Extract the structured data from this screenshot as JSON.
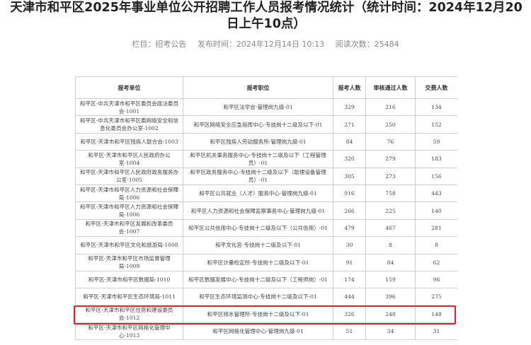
{
  "article": {
    "title": "天津市和平区2025年事业单位公开招聘工作人员报考情况统计（统计时间：2024年12月20日上午10点）",
    "column": "栏目：招考公告",
    "published": "发布时间：2024年12月14日 10:13",
    "views": "阅读次数：25484"
  },
  "table": {
    "headers": [
      "报考单位",
      "报考职位",
      "报考人数",
      "审核通过人数",
      "交费人数"
    ],
    "rows": [
      [
        "和平区-中共天津市和平区委员会政法委员会-1001",
        "和平区法学会-管理岗九级-01",
        "329",
        "216",
        "134"
      ],
      [
        "和平区-中共天津市和平区委网络安全和信息化委员会办公室-1002",
        "和平区网络安全应急指挥中心-专技岗十二级及以下-01",
        "271",
        "250",
        "152"
      ],
      [
        "和平区-天津市和平区残疾人联合会-1003",
        "和平区残疾人劳动服务所-管理岗九级-01",
        "84",
        "76",
        "59"
      ],
      [
        "和平区-天津市和平区人民政府办公室-1004",
        "和平区机关事务服务中心-专技岗十二级及以下（工程管理员）-01",
        "320",
        "279",
        "183"
      ],
      [
        "和平区-天津市和平区人民政府政务服务办公室-1005",
        "和平区政务服务中心-专技岗十二级及以下（助理设备管理员）-01",
        "305",
        "273",
        "156"
      ],
      [
        "和平区-天津市和平区人力资源和社会保障局-1006",
        "和平区公共就业（人才）服务中心-管理岗九级-01",
        "916",
        "758",
        "443"
      ],
      [
        "和平区-天津市和平区人力资源和社会保障局-1006",
        "和平区人力资源和社会保障监察事务中心-管理岗九级-01",
        "266",
        "225",
        "140"
      ],
      [
        "和平区-天津市和平区发展和改革委员会-1007",
        "和平区公共信用中心-专技岗十二级及以下（公共信用）-01",
        "479",
        "467",
        "281"
      ],
      [
        "和平区-天津市和平区文化和旅游局-1008",
        "和平文化宫-专技岗十二级及以下-01",
        "30",
        "8",
        "8"
      ],
      [
        "和平区-天津市和平区市场监督管理局-1009",
        "和平区计量检定所-专技岗十二级及以下-01",
        "91",
        "84",
        "62"
      ],
      [
        "和平区-天津市和平区数据局-1010",
        "和平区数据发展中心-专技岗十二级及以下（工程师岗）-01",
        "174",
        "159",
        "96"
      ],
      [
        "和平区-天津市和平区生态环境局-1011",
        "和平区生态环境监测中心-专技岗十二级及以下-01",
        "444",
        "396",
        "275"
      ],
      [
        "和平区-天津市和平区住房和建设委员会-1012",
        "和平区排水管理所-专技岗十二级及以下-01",
        "326",
        "248",
        "148"
      ],
      [
        "和平区-天津市和平区网格化管理中心-1013",
        "和平区网格化管理中心-管理岗九级-01",
        "51",
        "34",
        "31"
      ]
    ]
  }
}
